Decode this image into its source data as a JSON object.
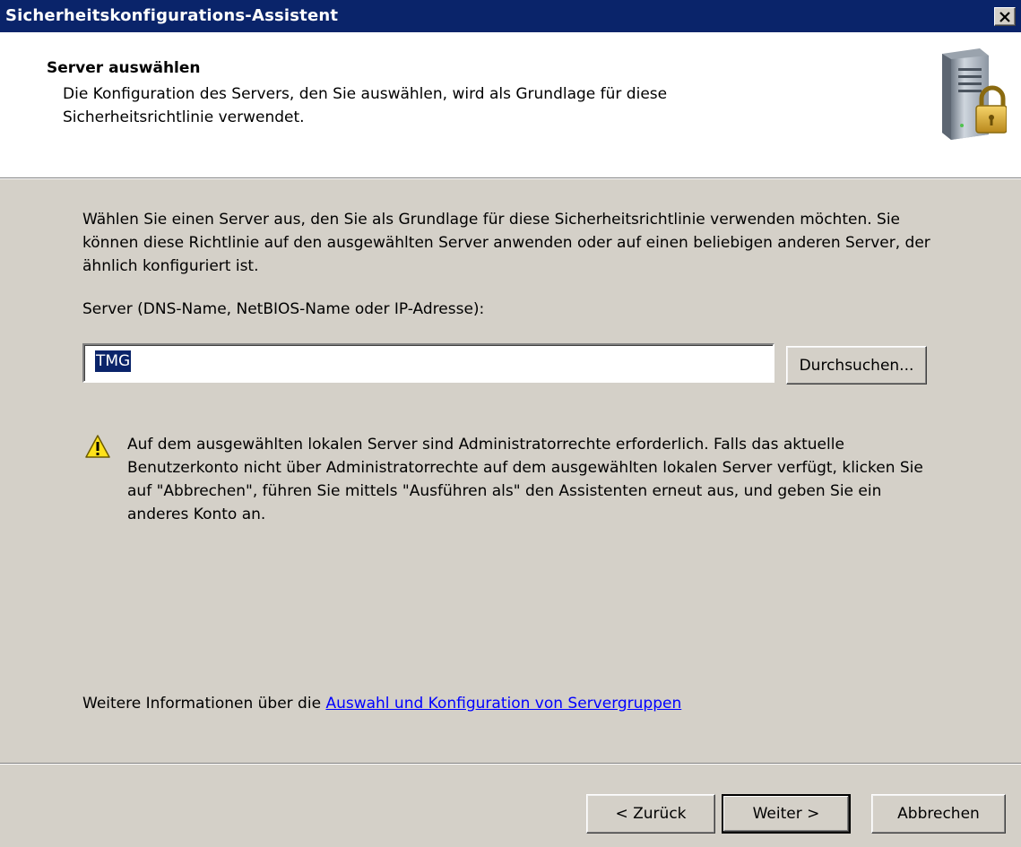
{
  "window": {
    "title": "Sicherheitskonfigurations-Assistent",
    "close_glyph": "✕"
  },
  "header": {
    "title": "Server auswählen",
    "description": "Die Konfiguration des Servers, den Sie auswählen, wird als Grundlage für diese Sicherheitsrichtlinie verwendet.",
    "icon": "server-lock-icon"
  },
  "main": {
    "intro": "Wählen Sie einen Server aus, den Sie als Grundlage für diese Sicherheitsrichtlinie verwenden möchten. Sie können diese Richtlinie auf den ausgewählten Server anwenden oder auf einen beliebigen anderen Server, der ähnlich konfiguriert ist.",
    "server_label": "Server (DNS-Name, NetBIOS-Name oder IP-Adresse):",
    "server_value": "TMG",
    "browse_label": "Durchsuchen...",
    "warning_icon": "warning-icon",
    "warning_text": "Auf dem ausgewählten lokalen Server sind Administratorrechte erforderlich. Falls das aktuelle Benutzerkonto nicht über Administratorrechte auf dem ausgewählten lokalen Server verfügt, klicken Sie auf \"Abbrechen\", führen Sie mittels \"Ausführen als\" den Assistenten erneut aus, und geben Sie ein anderes Konto an.",
    "more_info_prefix": "Weitere Informationen über die ",
    "more_info_link": "Auswahl und Konfiguration von Servergruppen"
  },
  "footer": {
    "back_label": "< Zurück",
    "next_label": "Weiter >",
    "cancel_label": "Abbrechen"
  },
  "colors": {
    "titlebar": "#0a246a",
    "dialog_bg": "#d4d0c8",
    "link": "#0000ff"
  }
}
